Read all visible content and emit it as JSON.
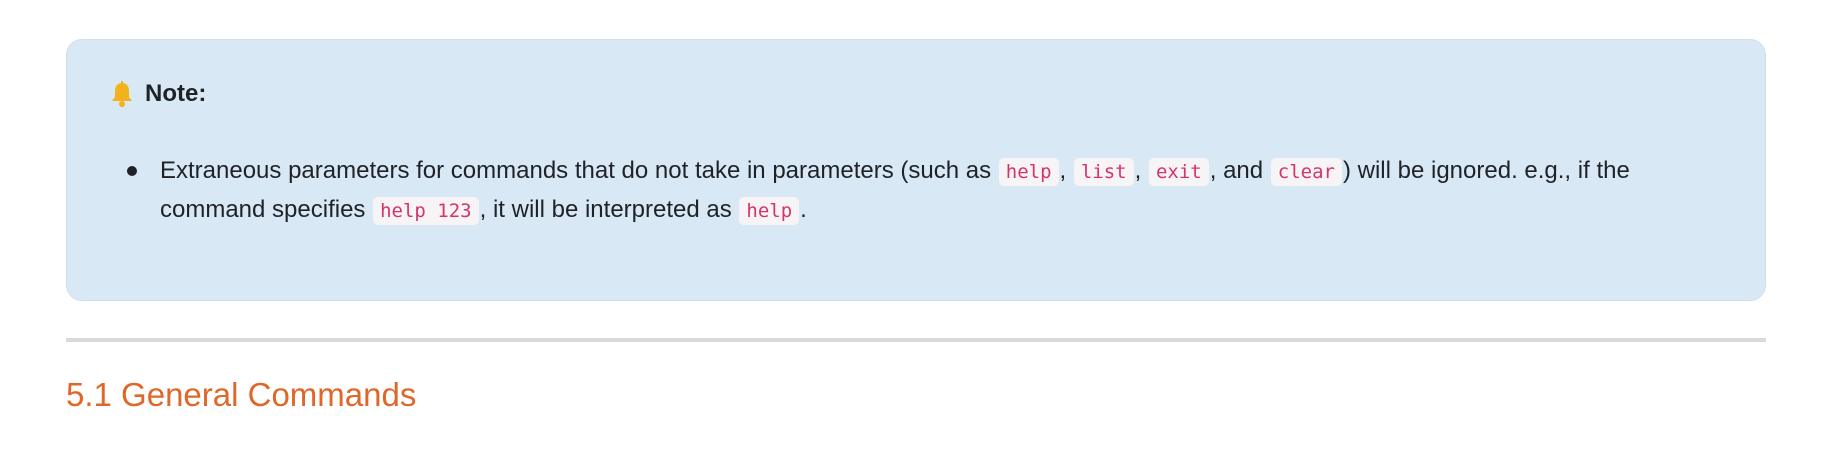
{
  "note": {
    "icon": "bell-icon",
    "icon_color": "#f3b21b",
    "title": "Note:",
    "background": "#d8e8f4",
    "item": {
      "text_1": "Extraneous parameters for commands that do not take in parameters (such as ",
      "code_help": "help",
      "sep_1": ", ",
      "code_list": "list",
      "sep_2": ", ",
      "code_exit": "exit",
      "sep_3": ", and ",
      "code_clear": "clear",
      "text_2": ") will be ignored. e.g., if the command specifies ",
      "code_help_123": "help 123",
      "text_3": ", it will be interpreted as ",
      "code_help_2": "help",
      "text_4": "."
    }
  },
  "section": {
    "title": "5.1 General Commands",
    "color": "#e0672a"
  },
  "code_color": "#d6336c"
}
